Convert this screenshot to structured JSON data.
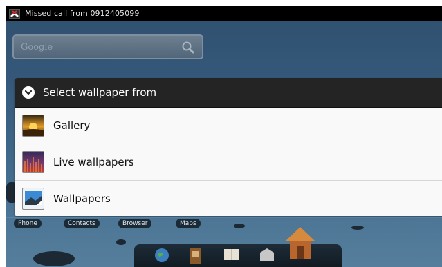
{
  "status_bar": {
    "notification_text": "Missed call from 0912405099"
  },
  "search": {
    "placeholder": "Google"
  },
  "dialog": {
    "title": "Select wallpaper from",
    "items": [
      {
        "label": "Gallery",
        "icon": "gallery-icon"
      },
      {
        "label": "Live wallpapers",
        "icon": "live-wallpapers-icon"
      },
      {
        "label": "Wallpapers",
        "icon": "wallpapers-icon"
      }
    ]
  },
  "dock": {
    "labels": [
      "Phone",
      "Contacts",
      "Browser",
      "Maps"
    ]
  },
  "colors": {
    "dialog_header": "#242424",
    "dialog_body": "#f9f9f9",
    "status_bar": "#000000"
  }
}
